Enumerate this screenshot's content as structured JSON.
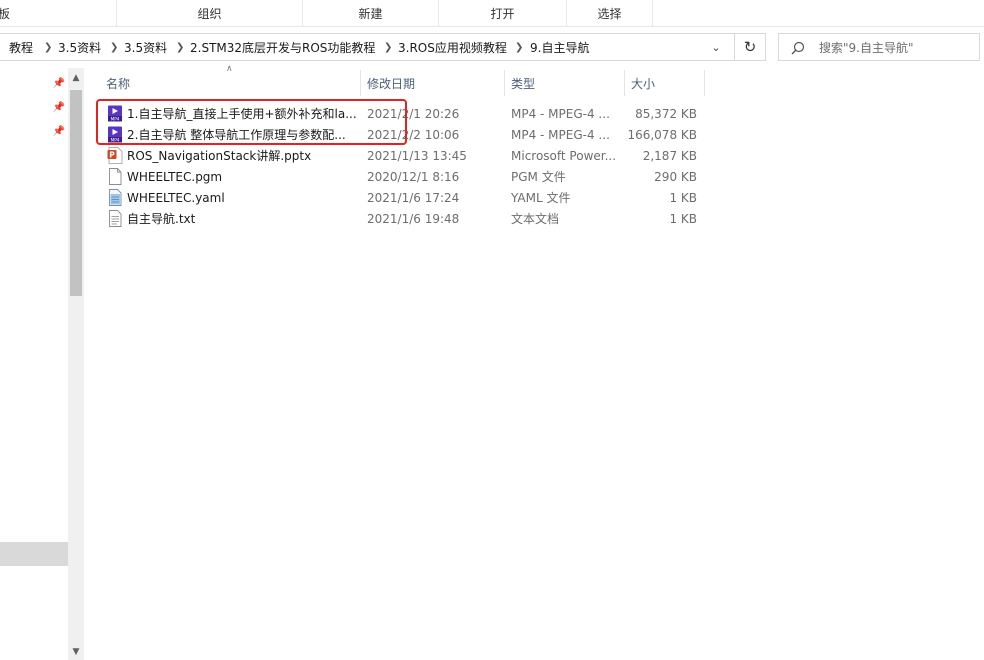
{
  "ribbon": {
    "groups": [
      "板",
      "组织",
      "新建",
      "打开",
      "选择"
    ]
  },
  "address": {
    "breadcrumbs": [
      "教程",
      "3.5资料",
      "3.5资料",
      "2.STM32底层开发与ROS功能教程",
      "3.ROS应用视频教程",
      "9.自主导航"
    ]
  },
  "search": {
    "placeholder": "搜索\"9.自主导航\""
  },
  "columns": {
    "name": "名称",
    "date": "修改日期",
    "type": "类型",
    "size": "大小"
  },
  "files": [
    {
      "name": "1.自主导航_直接上手使用+额外补充和la...",
      "date": "2021/2/1 20:26",
      "type": "MP4 - MPEG-4 ...",
      "size": "85,372 KB",
      "icon": "mp4-video-icon"
    },
    {
      "name": "2.自主导航 整体导航工作原理与参数配...",
      "date": "2021/2/2 10:06",
      "type": "MP4 - MPEG-4 ...",
      "size": "166,078 KB",
      "icon": "mp4-video-icon"
    },
    {
      "name": "ROS_NavigationStack讲解.pptx",
      "date": "2021/1/13 13:45",
      "type": "Microsoft Power...",
      "size": "2,187 KB",
      "icon": "powerpoint-icon"
    },
    {
      "name": "WHEELTEC.pgm",
      "date": "2020/12/1 8:16",
      "type": "PGM 文件",
      "size": "290 KB",
      "icon": "blank-file-icon"
    },
    {
      "name": "WHEELTEC.yaml",
      "date": "2021/1/6 17:24",
      "type": "YAML 文件",
      "size": "1 KB",
      "icon": "yaml-file-icon"
    },
    {
      "name": "自主导航.txt",
      "date": "2021/1/6 19:48",
      "type": "文本文档",
      "size": "1 KB",
      "icon": "text-file-icon"
    }
  ],
  "colors": {
    "highlight": "#e5221d",
    "header_text": "#4c607a",
    "mp4_icon": "#6b3fd0"
  }
}
